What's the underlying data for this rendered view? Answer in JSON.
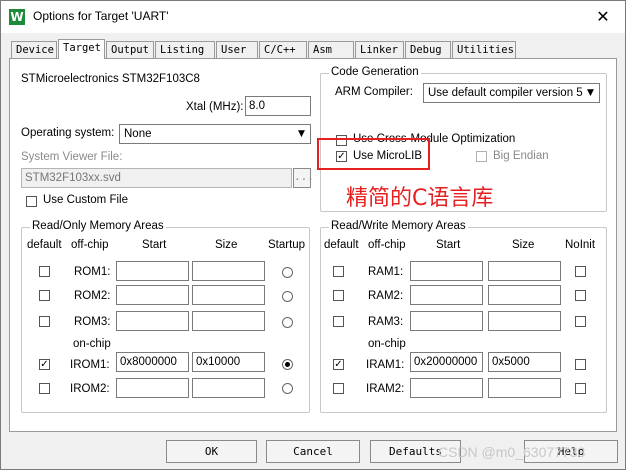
{
  "window": {
    "title": "Options for Target 'UART'",
    "app_icon_glyph": "W",
    "close_glyph": "✕"
  },
  "tabs": [
    {
      "label": "Device"
    },
    {
      "label": "Target"
    },
    {
      "label": "Output"
    },
    {
      "label": "Listing"
    },
    {
      "label": "User"
    },
    {
      "label": "C/C++"
    },
    {
      "label": "Asm"
    },
    {
      "label": "Linker"
    },
    {
      "label": "Debug"
    },
    {
      "label": "Utilities"
    }
  ],
  "device": {
    "name": "STMicroelectronics STM32F103C8",
    "xtal_label": "Xtal (MHz):",
    "xtal_value": "8.0",
    "os_label": "Operating system:",
    "os_value": "None",
    "svf_label": "System Viewer File:",
    "svf_value": "STM32F103xx.svd",
    "svf_browse": "...",
    "use_custom_file_label": "Use Custom File",
    "use_custom_file_checked": false
  },
  "codegen": {
    "title": "Code Generation",
    "arm_compiler_label": "ARM Compiler:",
    "arm_compiler_value": "Use default compiler version 5",
    "cross_module_label": "Use Cross-Module Optimization",
    "cross_module_checked": false,
    "microlib_label": "Use MicroLIB",
    "microlib_checked": true,
    "big_endian_label": "Big Endian",
    "big_endian_checked": false
  },
  "annotation": {
    "text": "精简的C语言库",
    "color": "#e62020"
  },
  "ro_memory": {
    "title": "Read/Only Memory Areas",
    "headers": {
      "default": "default",
      "offchip": "off-chip",
      "start": "Start",
      "size": "Size",
      "startup": "Startup"
    },
    "onchip_label": "on-chip",
    "rows": [
      {
        "name": "ROM1:",
        "start": "",
        "size": "",
        "default": false,
        "startup": false
      },
      {
        "name": "ROM2:",
        "start": "",
        "size": "",
        "default": false,
        "startup": false
      },
      {
        "name": "ROM3:",
        "start": "",
        "size": "",
        "default": false,
        "startup": false
      },
      {
        "name": "IROM1:",
        "start": "0x8000000",
        "size": "0x10000",
        "default": true,
        "startup": true
      },
      {
        "name": "IROM2:",
        "start": "",
        "size": "",
        "default": false,
        "startup": false
      }
    ]
  },
  "rw_memory": {
    "title": "Read/Write Memory Areas",
    "headers": {
      "default": "default",
      "offchip": "off-chip",
      "start": "Start",
      "size": "Size",
      "noinit": "NoInit"
    },
    "onchip_label": "on-chip",
    "rows": [
      {
        "name": "RAM1:",
        "start": "",
        "size": "",
        "default": false,
        "noinit": false
      },
      {
        "name": "RAM2:",
        "start": "",
        "size": "",
        "default": false,
        "noinit": false
      },
      {
        "name": "RAM3:",
        "start": "",
        "size": "",
        "default": false,
        "noinit": false
      },
      {
        "name": "IRAM1:",
        "start": "0x20000000",
        "size": "0x5000",
        "default": true,
        "noinit": false
      },
      {
        "name": "IRAM2:",
        "start": "",
        "size": "",
        "default": false,
        "noinit": false
      }
    ]
  },
  "buttons": {
    "ok": "OK",
    "cancel": "Cancel",
    "defaults": "Defaults",
    "help": "Help"
  },
  "watermark": "CSDN @m0_63077733"
}
